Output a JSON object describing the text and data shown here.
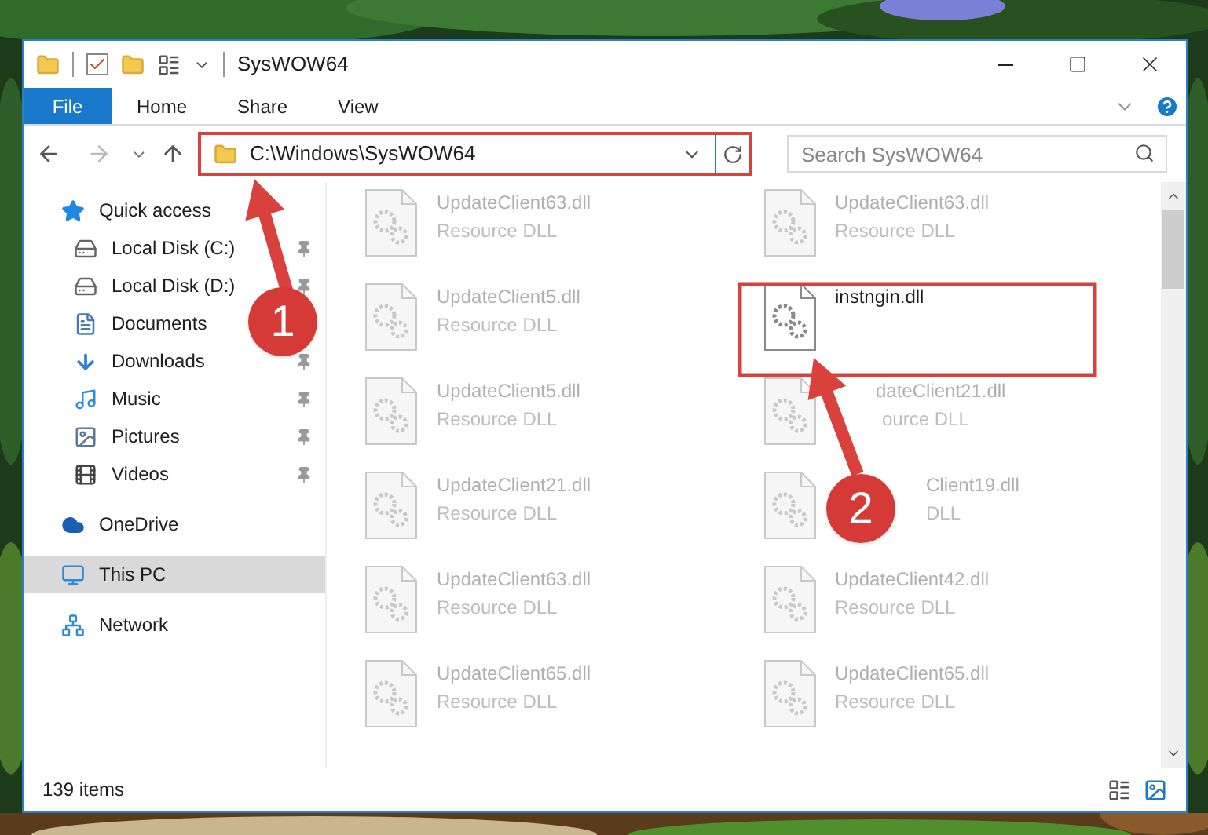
{
  "window": {
    "title": "SysWOW64"
  },
  "ribbon_tabs": [
    {
      "label": "File",
      "kind": "file"
    },
    {
      "label": "Home",
      "kind": "tab"
    },
    {
      "label": "Share",
      "kind": "tab"
    },
    {
      "label": "View",
      "kind": "tab"
    }
  ],
  "address_bar": {
    "path": "C:\\Windows\\SysWOW64"
  },
  "search": {
    "placeholder": "Search SysWOW64"
  },
  "sidebar": {
    "items": [
      {
        "label": "Quick access",
        "kind": "quick-access",
        "selected": false,
        "children": [
          {
            "label": "Local Disk (C:)",
            "kind": "drive-c",
            "selected": false,
            "pinned": true
          },
          {
            "label": "Local Disk (D:)",
            "kind": "drive",
            "selected": false,
            "pinned": true
          },
          {
            "label": "Documents",
            "kind": "documents",
            "selected": false
          },
          {
            "label": "Downloads",
            "kind": "downloads",
            "selected": false,
            "pinned": true
          },
          {
            "label": "Music",
            "kind": "music",
            "selected": false,
            "pinned": true
          },
          {
            "label": "Pictures",
            "kind": "pictures",
            "selected": false,
            "pinned": true
          },
          {
            "label": "Videos",
            "kind": "videos",
            "selected": false,
            "pinned": true
          }
        ]
      },
      {
        "label": "OneDrive",
        "kind": "onedrive",
        "selected": false
      },
      {
        "label": "This PC",
        "kind": "pc",
        "selected": true
      },
      {
        "label": "Network",
        "kind": "network",
        "selected": false
      }
    ]
  },
  "files": [
    {
      "name": "UpdateClient63.dll",
      "type": "Resource DLL",
      "faded": true
    },
    {
      "name": "UpdateClient63.dll",
      "type": "Resource DLL",
      "faded": true
    },
    {
      "name": "UpdateClient5.dll",
      "type": "Resource DLL",
      "faded": true
    },
    {
      "name": "instngin.dll",
      "faded": false
    },
    {
      "name": "UpdateClient5.dll",
      "type": "Resource DLL",
      "faded": true
    },
    {
      "name": "dateClient21.dll",
      "type": "ource DLL",
      "faded": true
    },
    {
      "name": "UpdateClient21.dll",
      "type": "Resource DLL",
      "faded": true
    },
    {
      "name": "Client19.dll",
      "type": "DLL",
      "faded": true
    },
    {
      "name": "UpdateClient63.dll",
      "type": "Resource DLL",
      "faded": true
    },
    {
      "name": "UpdateClient42.dll",
      "type": "Resource DLL",
      "faded": true
    },
    {
      "name": "UpdateClient65.dll",
      "type": "Resource DLL",
      "faded": true
    },
    {
      "name": "UpdateClient65.dll",
      "type": "Resource DLL",
      "faded": true
    }
  ],
  "status_bar": {
    "item_count": "139 items"
  },
  "annotations": [
    {
      "label": "1"
    },
    {
      "label": "2"
    }
  ]
}
